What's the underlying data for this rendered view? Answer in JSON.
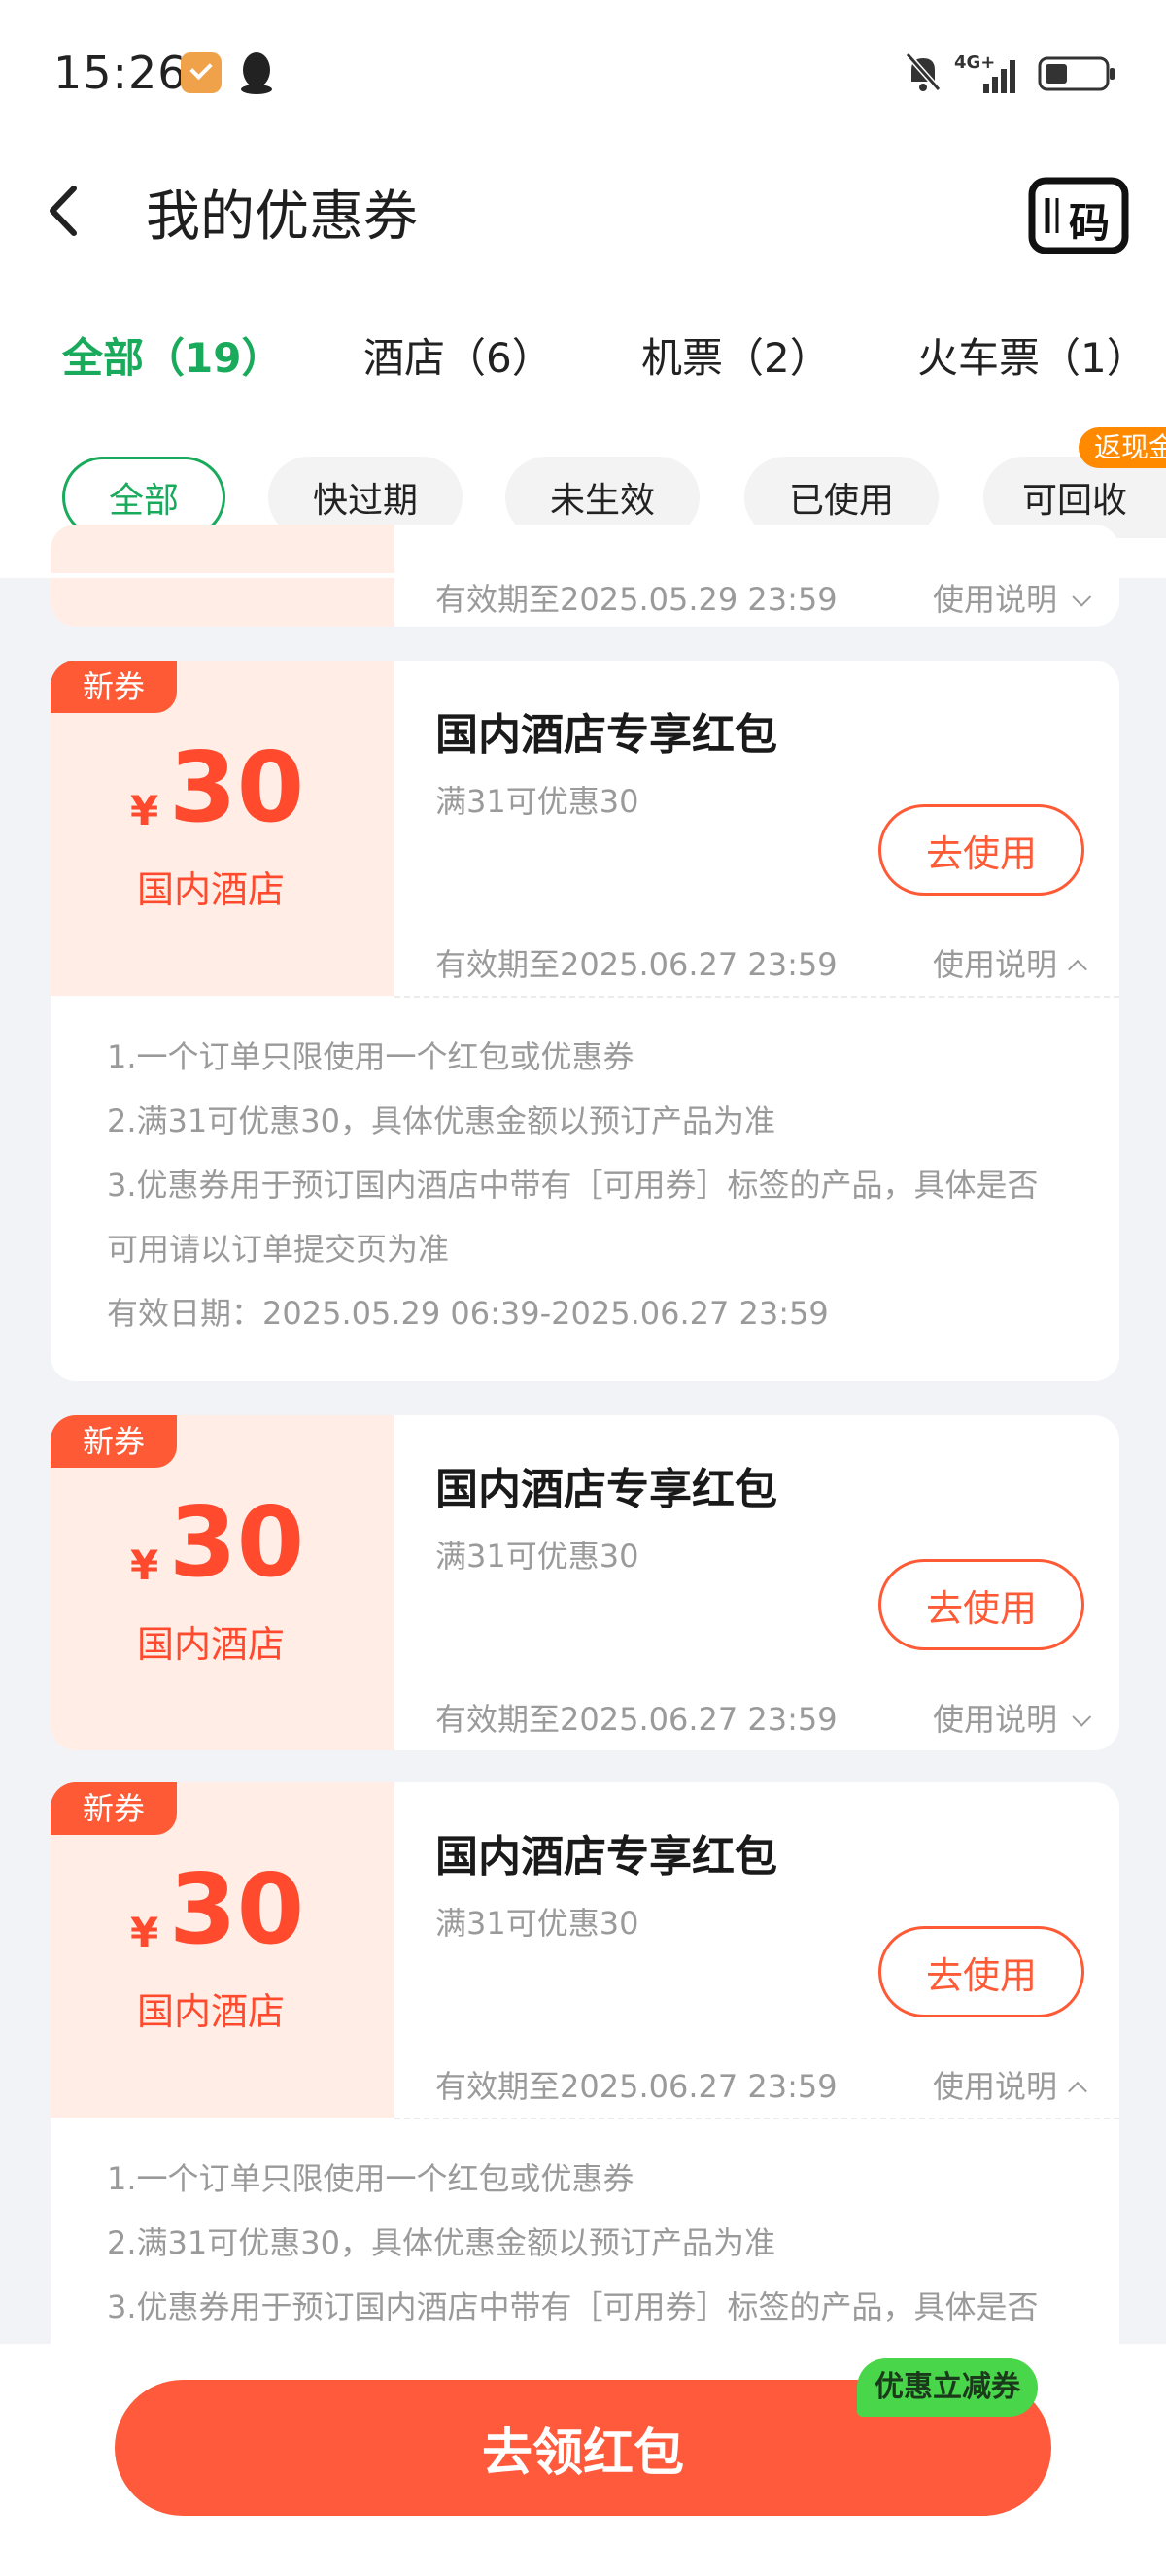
{
  "status_bar": {
    "time": "15:26",
    "network": "4G+"
  },
  "nav": {
    "title": "我的优惠券",
    "code_button": "码"
  },
  "tabs": [
    {
      "label": "全部（19）"
    },
    {
      "label": "酒店（6）"
    },
    {
      "label": "机票（2）"
    },
    {
      "label": "火车票（1）"
    }
  ],
  "filters": [
    {
      "label": "全部"
    },
    {
      "label": "快过期"
    },
    {
      "label": "未生效"
    },
    {
      "label": "已使用"
    },
    {
      "label": "可回收"
    }
  ],
  "filter_badge": "返现金",
  "partial_card": {
    "validity": "有效期至2025.05.29 23:59",
    "explain": "使用说明"
  },
  "coupons": [
    {
      "tag": "新券",
      "currency": "¥",
      "amount": "30",
      "scope": "国内酒店",
      "title": "国内酒店专享红包",
      "condition": "满31可优惠30",
      "button": "去使用",
      "validity": "有效期至2025.06.27 23:59",
      "explain": "使用说明",
      "details": [
        "1.一个订单只限使用一个红包或优惠券",
        "2.满31可优惠30，具体优惠金额以预订产品为准",
        "3.优惠券用于预订国内酒店中带有［可用券］标签的产品，具体是否",
        "可用请以订单提交页为准",
        "有效日期：2025.05.29 06:39-2025.06.27 23:59"
      ]
    },
    {
      "tag": "新券",
      "currency": "¥",
      "amount": "30",
      "scope": "国内酒店",
      "title": "国内酒店专享红包",
      "condition": "满31可优惠30",
      "button": "去使用",
      "validity": "有效期至2025.06.27 23:59",
      "explain": "使用说明"
    },
    {
      "tag": "新券",
      "currency": "¥",
      "amount": "30",
      "scope": "国内酒店",
      "title": "国内酒店专享红包",
      "condition": "满31可优惠30",
      "button": "去使用",
      "validity": "有效期至2025.06.27 23:59",
      "explain": "使用说明",
      "details": [
        "1.一个订单只限使用一个红包或优惠券",
        "2.满31可优惠30，具体优惠金额以预订产品为准",
        "3.优惠券用于预订国内酒店中带有［可用券］标签的产品，具体是否"
      ]
    }
  ],
  "bottom": {
    "button": "去领红包",
    "badge": "优惠立减券"
  },
  "colors": {
    "accent_green": "#1aaa5c",
    "coupon_red": "#ff4a2e",
    "coupon_bg": "#ffede6",
    "button_red": "#ff5a3c"
  }
}
